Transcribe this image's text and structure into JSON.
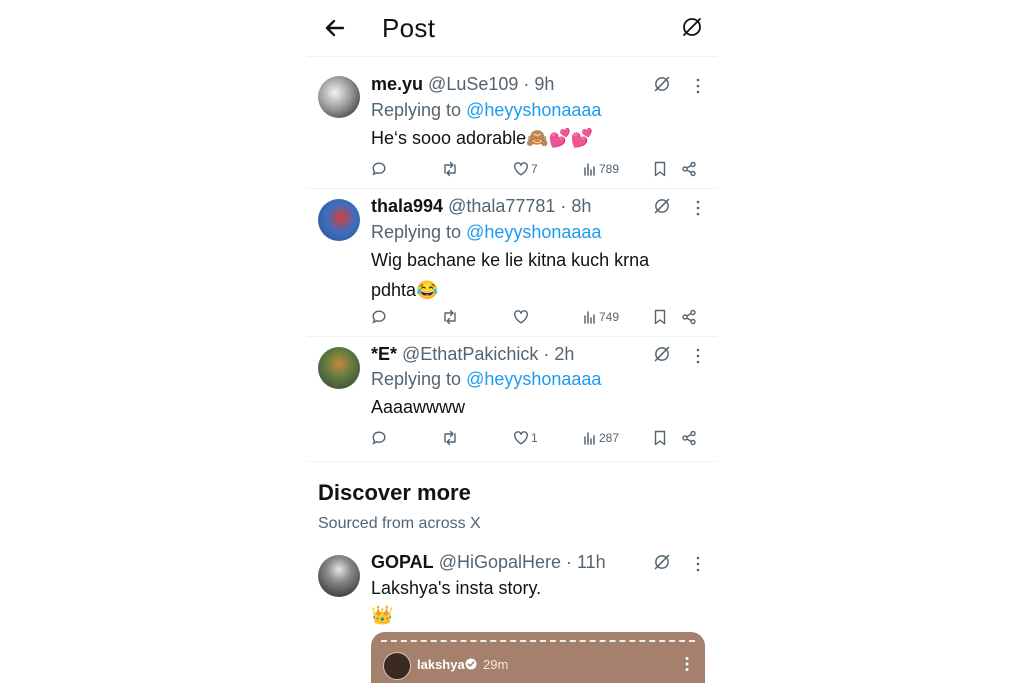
{
  "header": {
    "title": "Post"
  },
  "replies": [
    {
      "name": "me.yu",
      "handle_time": "@LuSe109 · 9h",
      "replying_label": "Replying to",
      "replying_handle": "@heyyshonaaaa",
      "text": "He‘s sooo adorable🙈💕💕",
      "likes": "7",
      "views": "789"
    },
    {
      "name": "thala994",
      "handle_time": "@thala77781 · 8h",
      "replying_label": "Replying to",
      "replying_handle": "@heyyshonaaaa",
      "text": "Wig bachane ke lie kitna kuch krna pdhta😂",
      "likes": "",
      "views": "749"
    },
    {
      "name": "*E*",
      "handle_time": "@EthatPakichick · 2h",
      "replying_label": "Replying to",
      "replying_handle": "@heyyshonaaaa",
      "text": "Aaaawwww",
      "likes": "1",
      "views": "287"
    }
  ],
  "discover": {
    "title": "Discover more",
    "subtitle": "Sourced from across X",
    "post": {
      "name": "GOPAL",
      "handle_time": "@HiGopalHere · 11h",
      "text_line1": "Lakshya's insta story.",
      "text_line2": "👑",
      "story_user": "lakshya",
      "story_time": "29m"
    }
  },
  "colors": {
    "link": "#1d9bf0",
    "secondary": "#536471",
    "divider": "#eff3f4",
    "media_bg": "#a4806d"
  },
  "icons": [
    "back-arrow-icon",
    "grok-icon",
    "more-icon",
    "reply-icon",
    "retweet-icon",
    "like-icon",
    "views-icon",
    "bookmark-icon",
    "share-icon",
    "verified-icon"
  ]
}
